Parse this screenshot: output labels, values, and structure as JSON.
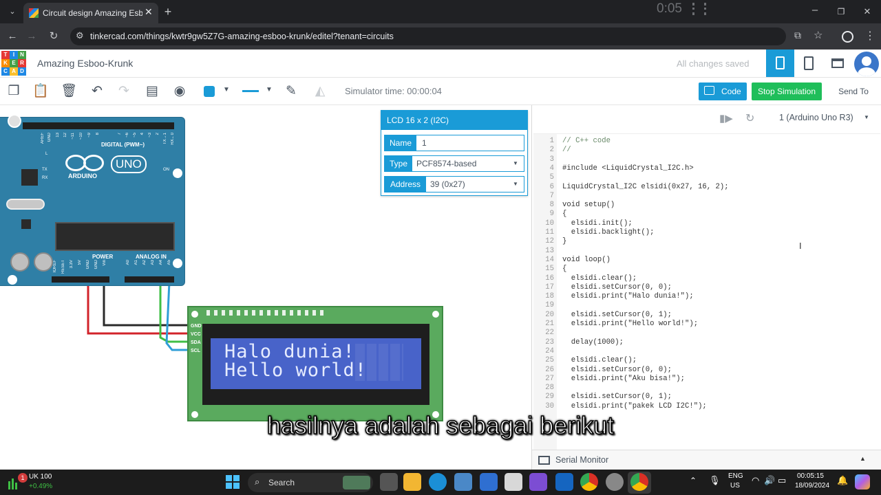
{
  "browser": {
    "tab_title": "Circuit design Amazing Esboo-K",
    "url": "tinkercad.com/things/kwtr9gw5Z7G-amazing-esboo-krunk/editel?tenant=circuits",
    "overlay_time": "0:05"
  },
  "header": {
    "logo_letters": [
      "T",
      "I",
      "N",
      "K",
      "E",
      "R",
      "C",
      "A",
      "D"
    ],
    "project_title": "Amazing Esboo-Krunk",
    "save_status": "All changes saved"
  },
  "toolbar": {
    "sim_time": "Simulator time: 00:00:04",
    "code_label": "Code",
    "stop_label": "Stop Simulation",
    "send_label": "Send To"
  },
  "inspector": {
    "title": "LCD 16 x 2 (I2C)",
    "fields": [
      {
        "label": "Name",
        "value": "1"
      },
      {
        "label": "Type",
        "value": "PCF8574-based"
      },
      {
        "label": "Address",
        "value": "39 (0x27)"
      }
    ]
  },
  "arduino": {
    "digital_label": "DIGITAL (PWM~)",
    "brand": "ARDUINO",
    "model": "UNO",
    "on_label": "ON",
    "power_label": "POWER",
    "analog_label": "ANALOG IN",
    "left_top_labels": [
      "AREF",
      "GND",
      "13",
      "12",
      "~11",
      "~10",
      "~9",
      "8"
    ],
    "right_top_labels": [
      "7",
      "~6",
      "~5",
      "4",
      "~3",
      "2",
      "TX→1",
      "RX←0"
    ],
    "power_pins": [
      "IOREF",
      "RESET",
      "3.3V",
      "5V",
      "GND",
      "GND",
      "Vin"
    ],
    "analog_pins": [
      "A0",
      "A1",
      "A2",
      "A3",
      "A4",
      "A5"
    ],
    "side_labels": [
      "L",
      "TX",
      "RX"
    ]
  },
  "lcd": {
    "pins": [
      "GND",
      "VCC",
      "SDA",
      "SCL"
    ],
    "line1": "Halo dunia!",
    "line2": "Hello world!"
  },
  "code_panel": {
    "device": "1 (Arduino Uno R3)",
    "lines": [
      {
        "n": "1",
        "t": "// C++ code"
      },
      {
        "n": "2",
        "t": "//"
      },
      {
        "n": "3",
        "t": ""
      },
      {
        "n": "4",
        "t": "#include <LiquidCrystal_I2C.h>"
      },
      {
        "n": "5",
        "t": ""
      },
      {
        "n": "6",
        "t": "LiquidCrystal_I2C elsidi(0x27, 16, 2);"
      },
      {
        "n": "7",
        "t": ""
      },
      {
        "n": "8",
        "t": "void setup()"
      },
      {
        "n": "9",
        "t": "{"
      },
      {
        "n": "10",
        "t": "  elsidi.init();"
      },
      {
        "n": "11",
        "t": "  elsidi.backlight();"
      },
      {
        "n": "12",
        "t": "}"
      },
      {
        "n": "13",
        "t": ""
      },
      {
        "n": "14",
        "t": "void loop()"
      },
      {
        "n": "15",
        "t": "{"
      },
      {
        "n": "16",
        "t": "  elsidi.clear();"
      },
      {
        "n": "17",
        "t": "  elsidi.setCursor(0, 0);"
      },
      {
        "n": "18",
        "t": "  elsidi.print(\"Halo dunia!\");"
      },
      {
        "n": "19",
        "t": ""
      },
      {
        "n": "20",
        "t": "  elsidi.setCursor(0, 1);"
      },
      {
        "n": "21",
        "t": "  elsidi.print(\"Hello world!\");"
      },
      {
        "n": "22",
        "t": ""
      },
      {
        "n": "23",
        "t": "  delay(1000);"
      },
      {
        "n": "24",
        "t": ""
      },
      {
        "n": "25",
        "t": "  elsidi.clear();"
      },
      {
        "n": "26",
        "t": "  elsidi.setCursor(0, 0);"
      },
      {
        "n": "27",
        "t": "  elsidi.print(\"Aku bisa!\");"
      },
      {
        "n": "28",
        "t": ""
      },
      {
        "n": "29",
        "t": "  elsidi.setCursor(0, 1);"
      },
      {
        "n": "30",
        "t": "  elsidi.print(\"pakek LCD I2C!\");"
      }
    ],
    "serial_monitor": "Serial Monitor"
  },
  "subtitle": "hasilnya adalah sebagai berikut",
  "taskbar": {
    "stock_name": "UK 100",
    "stock_change": "+0.49%",
    "notification_count": "1",
    "search_label": "Search",
    "lang_line1": "ENG",
    "lang_line2": "US",
    "time": "00:05:15",
    "date": "18/09/2024"
  },
  "colors": {
    "tinkercad_blue": "#1a9bd7",
    "stop_green": "#1fbe5a",
    "arduino_teal": "#2f7fa6",
    "lcd_screen": "#4863c9",
    "lcd_board": "#5aaa5e"
  }
}
